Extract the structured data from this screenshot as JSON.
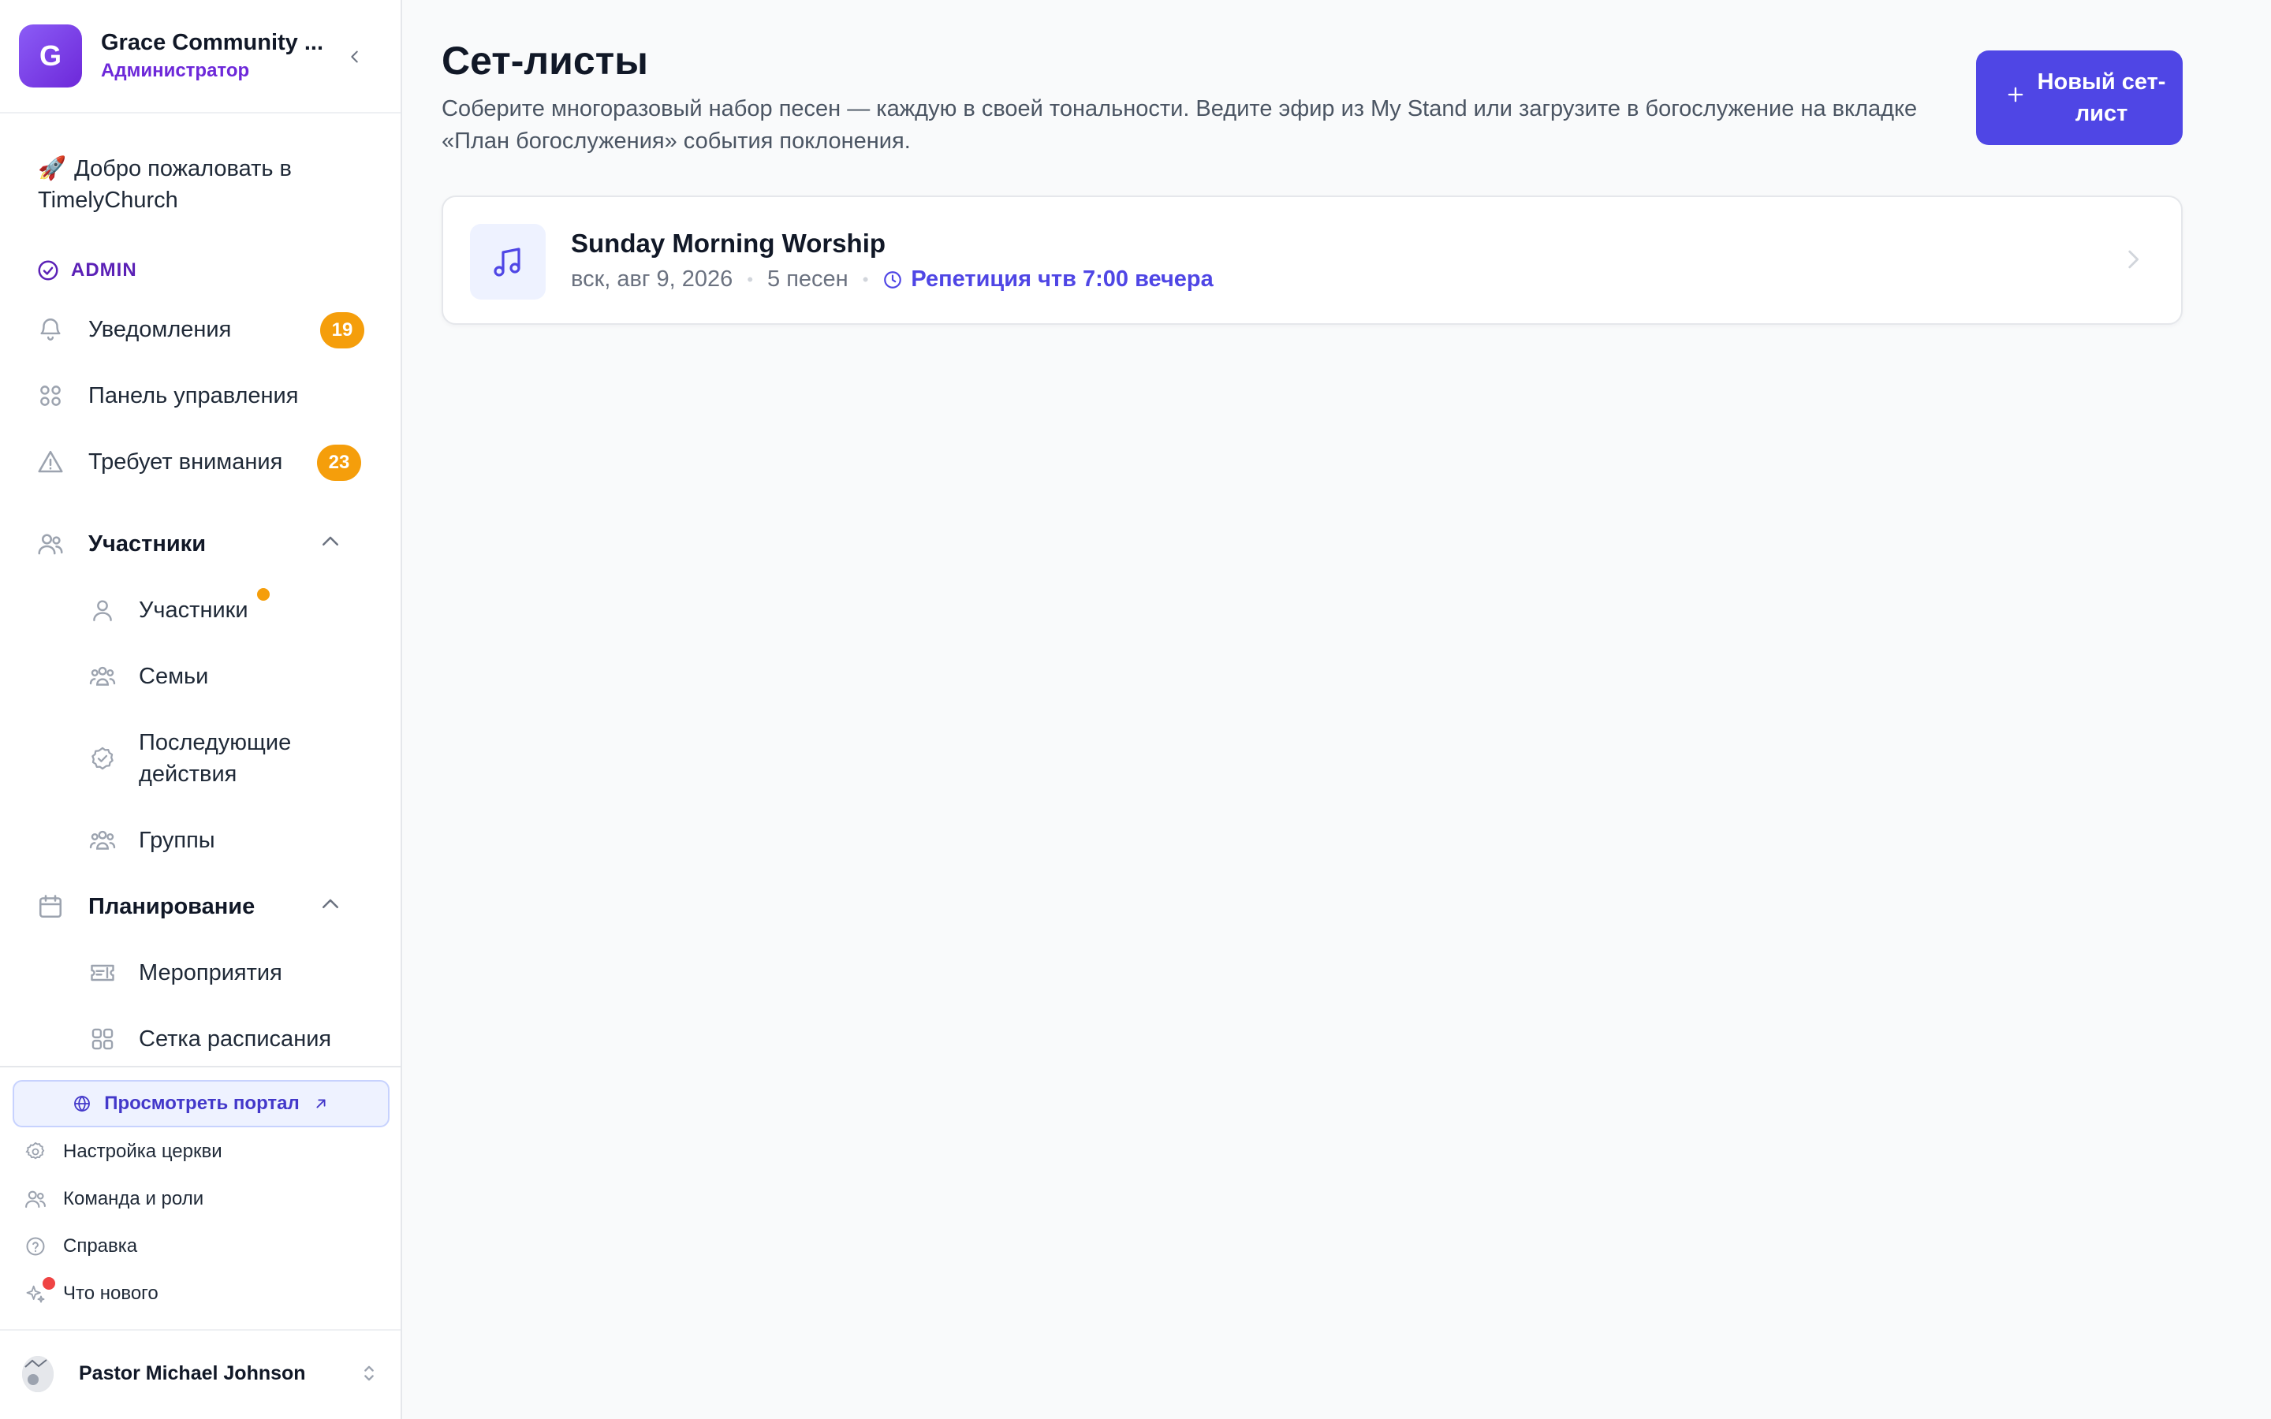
{
  "org": {
    "avatar_letter": "G",
    "name": "Grace Community ...",
    "role": "Администратор"
  },
  "welcome": {
    "emoji": "🚀",
    "text": "Добро пожаловать в TimelyChurch"
  },
  "admin_label": "ADMIN",
  "nav": {
    "notifications": {
      "label": "Уведомления",
      "badge": "19"
    },
    "dashboard": {
      "label": "Панель управления"
    },
    "attention": {
      "label": "Требует внимания",
      "badge": "23"
    },
    "people_section": {
      "label": "Участники"
    },
    "people": {
      "label": "Участники"
    },
    "families": {
      "label": "Семьи"
    },
    "followups": {
      "label": "Последующие действия"
    },
    "groups": {
      "label": "Группы"
    },
    "planning_section": {
      "label": "Планирование"
    },
    "events": {
      "label": "Мероприятия"
    },
    "schedule_grid": {
      "label": "Сетка расписания"
    }
  },
  "footer": {
    "portal_button": "Просмотреть портал",
    "church_settings": "Настройка церкви",
    "team_roles": "Команда и роли",
    "help": "Справка",
    "whats_new": "Что нового"
  },
  "user": {
    "name": "Pastor Michael Johnson"
  },
  "page": {
    "title": "Сет-листы",
    "description": "Соберите многоразовый набор песен — каждую в своей тональности. Ведите эфир из My Stand или загрузите в богослужение на вкладке «План богослужения» события поклонения.",
    "new_button": "Новый сет-лист"
  },
  "setlists": [
    {
      "title": "Sunday Morning Worship",
      "date": "вск, авг 9, 2026",
      "songs": "5 песен",
      "rehearsal": "Репетиция чтв 7:00 вечера"
    }
  ],
  "colors": {
    "accent": "#4f46e5",
    "brand_purple": "#6d28d9",
    "badge_orange": "#f59e0b",
    "dot_red": "#ef4444"
  }
}
